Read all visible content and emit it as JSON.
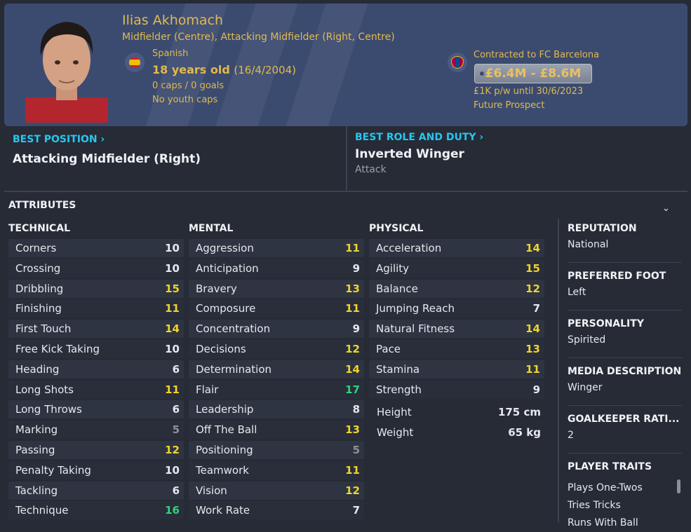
{
  "player": {
    "name": "Ilias Akhomach",
    "positions": "Midfielder (Centre), Attacking Midfielder (Right, Centre)",
    "nationality": "Spanish",
    "age": "18 years old",
    "dob": "(16/4/2004)",
    "caps": "0 caps / 0 goals",
    "youth_caps": "No youth caps",
    "contract": "Contracted to FC Barcelona",
    "value": "£6.4M - £8.6M",
    "wage": "£1K p/w until 30/6/2023",
    "status": "Future Prospect"
  },
  "best_position": {
    "label": "BEST POSITION",
    "value": "Attacking Midfielder (Right)"
  },
  "best_role": {
    "label": "BEST ROLE AND DUTY",
    "value": "Inverted Winger",
    "duty": "Attack"
  },
  "attributes_title": "ATTRIBUTES",
  "technical": {
    "title": "TECHNICAL",
    "items": [
      {
        "name": "Corners",
        "value": "10"
      },
      {
        "name": "Crossing",
        "value": "10"
      },
      {
        "name": "Dribbling",
        "value": "15"
      },
      {
        "name": "Finishing",
        "value": "11"
      },
      {
        "name": "First Touch",
        "value": "14"
      },
      {
        "name": "Free Kick Taking",
        "value": "10"
      },
      {
        "name": "Heading",
        "value": "6"
      },
      {
        "name": "Long Shots",
        "value": "11"
      },
      {
        "name": "Long Throws",
        "value": "6"
      },
      {
        "name": "Marking",
        "value": "5"
      },
      {
        "name": "Passing",
        "value": "12"
      },
      {
        "name": "Penalty Taking",
        "value": "10"
      },
      {
        "name": "Tackling",
        "value": "6"
      },
      {
        "name": "Technique",
        "value": "16"
      }
    ]
  },
  "mental": {
    "title": "MENTAL",
    "items": [
      {
        "name": "Aggression",
        "value": "11"
      },
      {
        "name": "Anticipation",
        "value": "9"
      },
      {
        "name": "Bravery",
        "value": "13"
      },
      {
        "name": "Composure",
        "value": "11"
      },
      {
        "name": "Concentration",
        "value": "9"
      },
      {
        "name": "Decisions",
        "value": "12"
      },
      {
        "name": "Determination",
        "value": "14"
      },
      {
        "name": "Flair",
        "value": "17"
      },
      {
        "name": "Leadership",
        "value": "8"
      },
      {
        "name": "Off The Ball",
        "value": "13"
      },
      {
        "name": "Positioning",
        "value": "5"
      },
      {
        "name": "Teamwork",
        "value": "11"
      },
      {
        "name": "Vision",
        "value": "12"
      },
      {
        "name": "Work Rate",
        "value": "7"
      }
    ]
  },
  "physical": {
    "title": "PHYSICAL",
    "items": [
      {
        "name": "Acceleration",
        "value": "14"
      },
      {
        "name": "Agility",
        "value": "15"
      },
      {
        "name": "Balance",
        "value": "12"
      },
      {
        "name": "Jumping Reach",
        "value": "7"
      },
      {
        "name": "Natural Fitness",
        "value": "14"
      },
      {
        "name": "Pace",
        "value": "13"
      },
      {
        "name": "Stamina",
        "value": "11"
      },
      {
        "name": "Strength",
        "value": "9"
      }
    ],
    "height_label": "Height",
    "height": "175 cm",
    "weight_label": "Weight",
    "weight": "65 kg"
  },
  "side": {
    "reputation_label": "REPUTATION",
    "reputation": "National",
    "foot_label": "PREFERRED FOOT",
    "foot": "Left",
    "personality_label": "PERSONALITY",
    "personality": "Spirited",
    "media_label": "MEDIA DESCRIPTION",
    "media": "Winger",
    "gk_label": "GOALKEEPER RATI...",
    "gk": "2",
    "traits_label": "PLAYER TRAITS",
    "traits": [
      "Plays One-Twos",
      "Tries Tricks",
      "Runs With Ball"
    ]
  },
  "colors": {
    "header_bg": "#3b4b70",
    "gold": "#e2b94e",
    "link": "#27c7f0",
    "attr_high": "#2ed47a",
    "attr_good": "#f0d32c",
    "attr_mid": "#e6e8ee",
    "attr_low": "#8d929c"
  }
}
